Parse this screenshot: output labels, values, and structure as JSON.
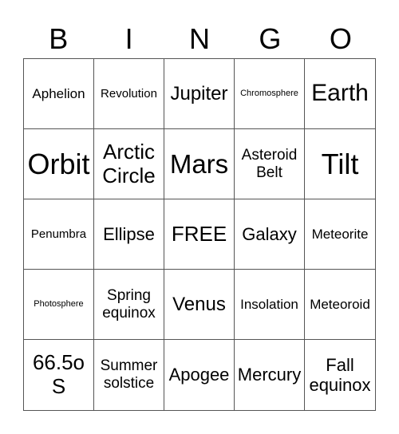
{
  "header": [
    "B",
    "I",
    "N",
    "G",
    "O"
  ],
  "cells": [
    {
      "text": "Aphelion",
      "size": "s17"
    },
    {
      "text": "Revolution",
      "size": "s15"
    },
    {
      "text": "Jupiter",
      "size": "s24"
    },
    {
      "text": "Chromosphere",
      "size": "s11"
    },
    {
      "text": "Earth",
      "size": "s30"
    },
    {
      "text": "Orbit",
      "size": "s36"
    },
    {
      "text": "Arctic Circle",
      "size": "s26"
    },
    {
      "text": "Mars",
      "size": "s33"
    },
    {
      "text": "Asteroid Belt",
      "size": "s19"
    },
    {
      "text": "Tilt",
      "size": "s36"
    },
    {
      "text": "Penumbra",
      "size": "s15"
    },
    {
      "text": "Ellipse",
      "size": "s22"
    },
    {
      "text": "FREE",
      "size": "s26"
    },
    {
      "text": "Galaxy",
      "size": "s22"
    },
    {
      "text": "Meteorite",
      "size": "s17"
    },
    {
      "text": "Photosphere",
      "size": "s11"
    },
    {
      "text": "Spring equinox",
      "size": "s19"
    },
    {
      "text": "Venus",
      "size": "s24"
    },
    {
      "text": "Insolation",
      "size": "s17"
    },
    {
      "text": "Meteoroid",
      "size": "s17"
    },
    {
      "text": "66.5o S",
      "size": "s26"
    },
    {
      "text": "Summer solstice",
      "size": "s19"
    },
    {
      "text": "Apogee",
      "size": "s22"
    },
    {
      "text": "Mercury",
      "size": "s22"
    },
    {
      "text": "Fall equinox",
      "size": "s22"
    }
  ]
}
